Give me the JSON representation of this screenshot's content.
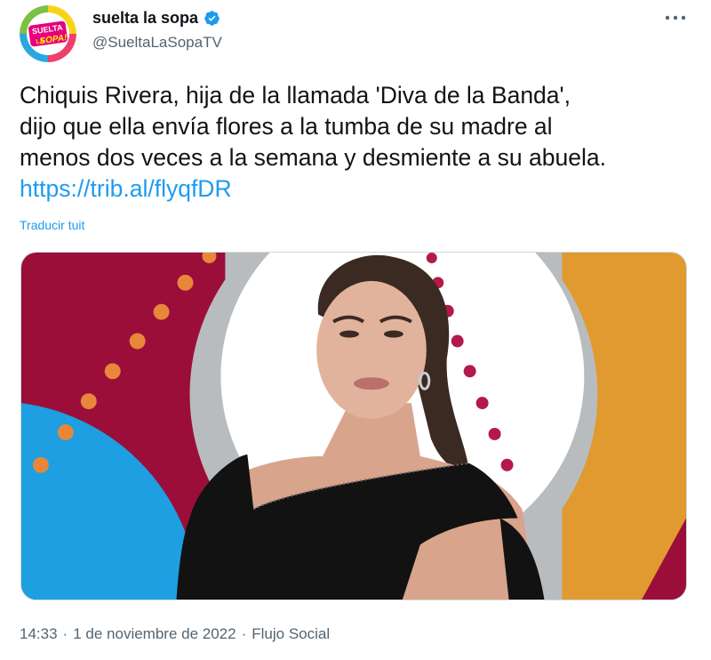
{
  "account": {
    "display_name": "suelta la sopa",
    "handle": "@SueltaLaSopaTV",
    "avatar_text_1": "SUELTA",
    "avatar_text_2": "LA",
    "avatar_text_3": "SOPA!"
  },
  "tweet": {
    "text_lines": [
      "Chiquis Rivera, hija de la llamada 'Diva de la Banda',",
      "dijo que ella envía flores a la tumba de su madre al",
      "menos dos veces a la semana y desmiente a su abuela."
    ],
    "link": "https://trib.al/flyqfDR",
    "translate_label": "Traducir tuit"
  },
  "footer": {
    "time": "14:33",
    "date": "1 de noviembre de 2022",
    "source": "Flujo Social",
    "separator": "·"
  },
  "colors": {
    "accent": "#1d9bf0",
    "media_red": "#9b0e3a",
    "media_blue": "#1d9fe2",
    "media_orange": "#e09a2f",
    "media_gray": "#b9bcbf",
    "dots": "#e8873a"
  }
}
